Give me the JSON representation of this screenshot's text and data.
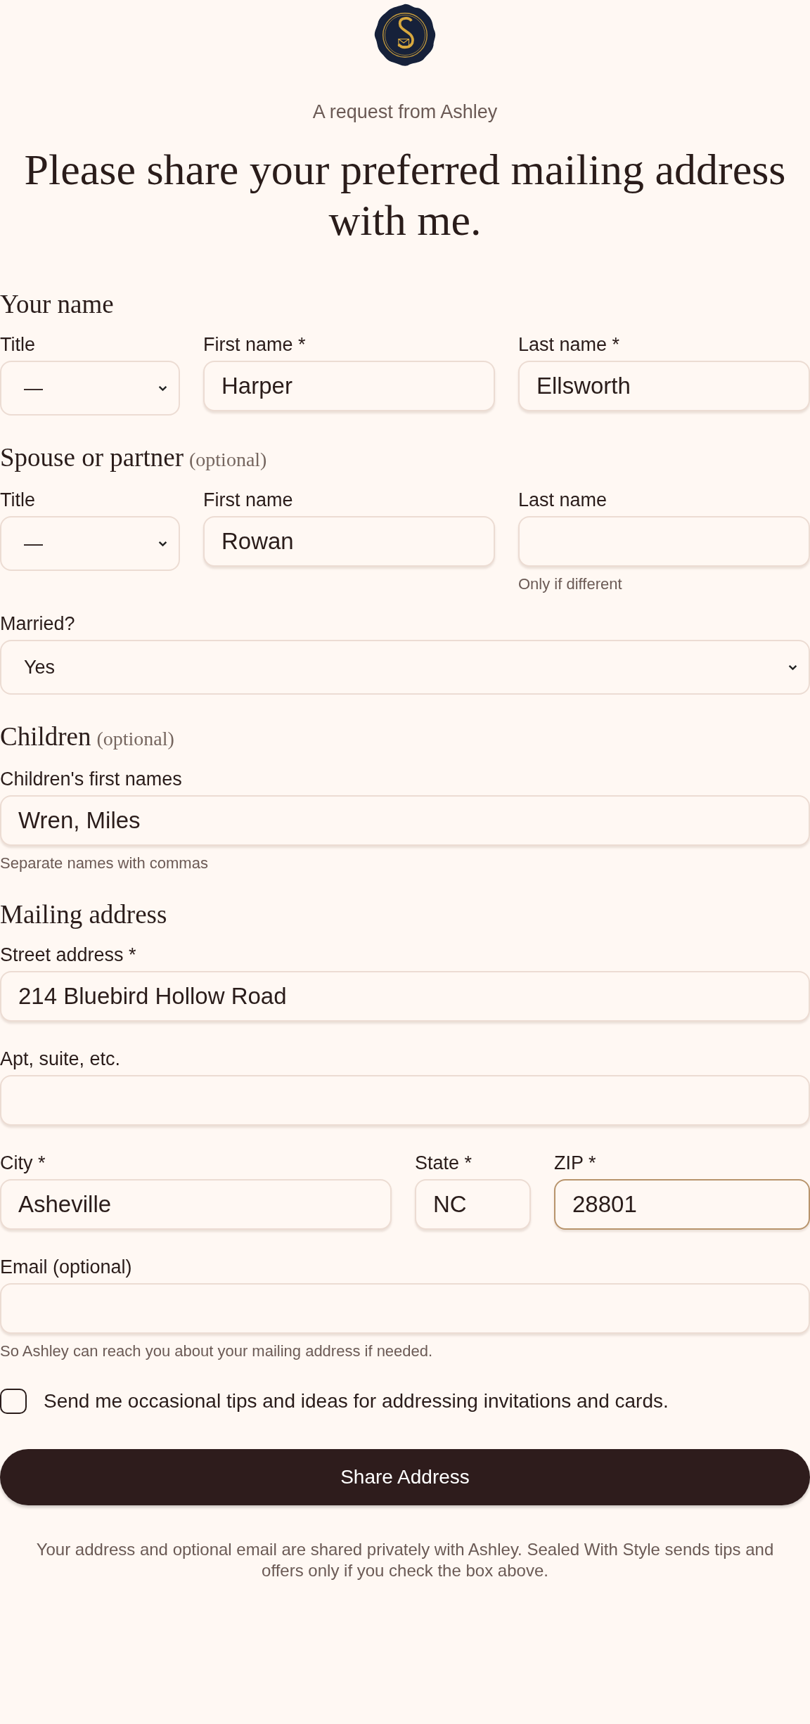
{
  "request_line": "A request from Ashley",
  "heading": "Please share your preferred mailing address with me.",
  "sections": [
    {
      "heading": "Your name",
      "rows": [
        [
          {
            "kind": "select",
            "label": "Title",
            "value": "—"
          },
          {
            "kind": "text",
            "label": "First name *",
            "value": "Harper",
            "focused": false
          },
          {
            "kind": "text",
            "label": "Last name *",
            "value": "Ellsworth",
            "focused": false
          }
        ]
      ]
    },
    {
      "heading": "Spouse or partner",
      "note": "(optional)",
      "rows": [
        [
          {
            "kind": "select",
            "label": "Title",
            "value": "—"
          },
          {
            "kind": "text",
            "label": "First name",
            "value": "Rowan",
            "focused": false
          },
          {
            "kind": "text",
            "label": "Last name",
            "hint": "Only if different",
            "focused": false
          }
        ],
        [
          {
            "kind": "select",
            "label": "Married?",
            "value": "Yes"
          }
        ]
      ]
    },
    {
      "heading": "Children",
      "note": "(optional)",
      "rows": [
        [
          {
            "kind": "text",
            "label": "Children's first names",
            "value": "Wren, Miles",
            "hint": "Separate names with commas",
            "focused": false
          }
        ]
      ]
    },
    {
      "heading": "Mailing address",
      "rows": [
        [
          {
            "kind": "text",
            "label": "Street address *",
            "value": "214 Bluebird Hollow Road",
            "focused": false
          }
        ],
        [
          {
            "kind": "text",
            "label": "Apt, suite, etc.",
            "focused": false
          }
        ],
        [
          {
            "kind": "text",
            "label": "City *",
            "value": "Asheville",
            "focused": false
          },
          {
            "kind": "text",
            "label": "State *",
            "value": "NC",
            "focused": false
          },
          {
            "kind": "text",
            "label": "ZIP *",
            "value": "28801",
            "focused": true
          }
        ],
        [
          {
            "kind": "text",
            "label": "Email (optional)",
            "hint": "So Ashley can reach you about your mailing address if needed.",
            "focused": false
          }
        ]
      ]
    }
  ],
  "newsletter": {
    "label": "Send me occasional tips and ideas for addressing invitations and cards.",
    "checked": false
  },
  "submit_button": "Share Address",
  "footer": "Your address and optional email are shared privately with Ashley. Sealed With Style sends tips and offers only if you check the box above."
}
